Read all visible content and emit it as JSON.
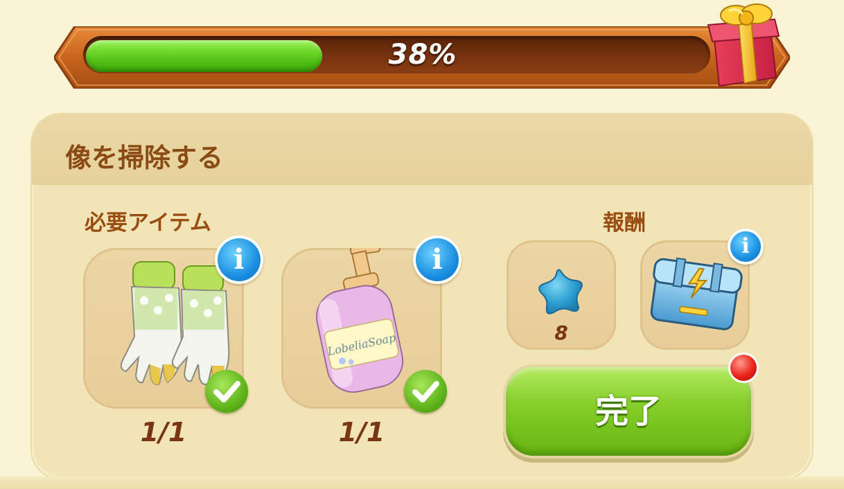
{
  "progress": {
    "percent_label": "38%",
    "value": 0.38
  },
  "task": {
    "title": "像を掃除する"
  },
  "required_items": {
    "label": "必要アイテム",
    "items": [
      {
        "name": "gloves",
        "count": "1/1",
        "complete": true
      },
      {
        "name": "soap-bottle",
        "count": "1/1",
        "complete": true
      }
    ]
  },
  "rewards": {
    "label": "報酬",
    "items": [
      {
        "name": "star-icon",
        "count": "8"
      },
      {
        "name": "energy-chest-icon"
      }
    ]
  },
  "complete_button": {
    "label": "完了"
  },
  "icons": {
    "gift": "gift-box-icon",
    "info": "info-icon",
    "check": "check-icon"
  },
  "colors": {
    "progress_fill": "#6fd72a",
    "progress_track": "#7a3410",
    "title_text": "#8a4a14",
    "button_green": "#88d02c",
    "notification_red": "#e8231a",
    "info_blue": "#1a8fe0"
  }
}
